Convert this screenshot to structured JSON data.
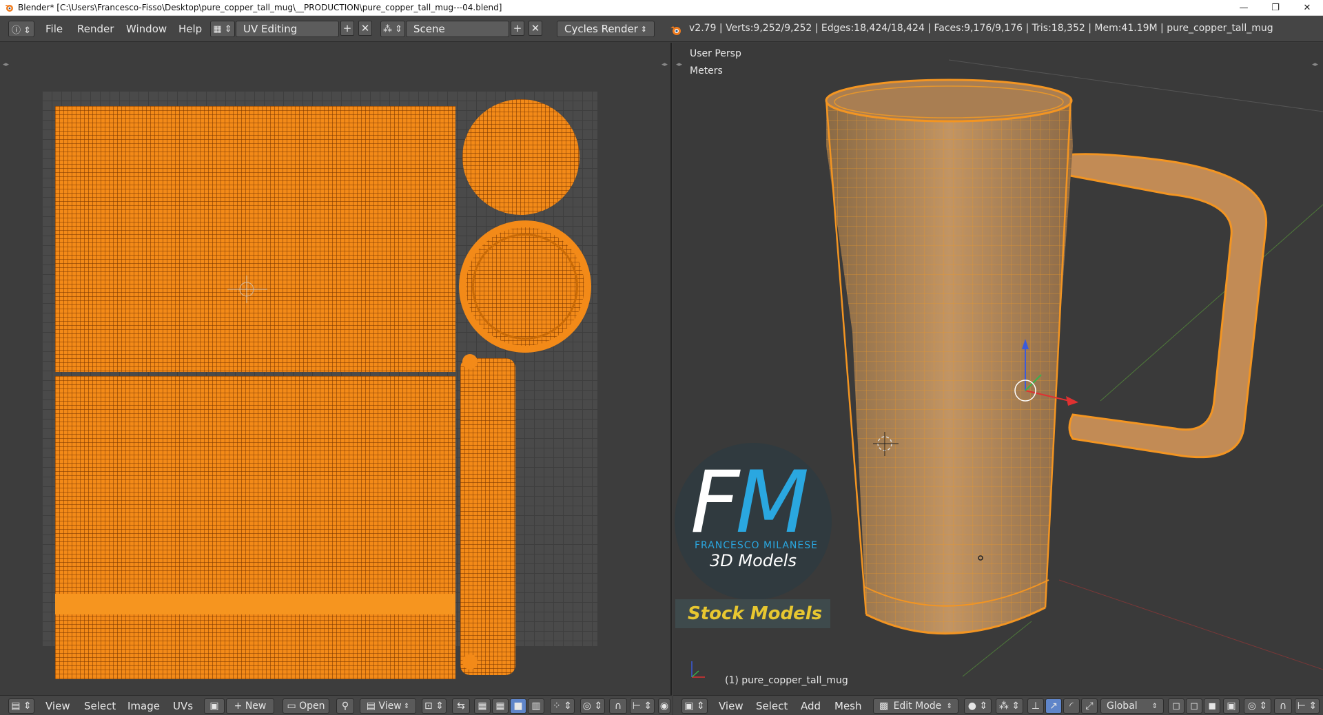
{
  "window": {
    "title": "Blender* [C:\\Users\\Francesco-Fisso\\Desktop\\pure_copper_tall_mug\\__PRODUCTION\\pure_copper_tall_mug---04.blend]",
    "minimize": "—",
    "maximize": "❐",
    "close": "✕"
  },
  "info_header": {
    "menus": [
      "File",
      "Render",
      "Window",
      "Help"
    ],
    "screen_layout": "UV Editing",
    "scene": "Scene",
    "render_engine": "Cycles Render",
    "stats": "v2.79 | Verts:9,252/9,252 | Edges:18,424/18,424 | Faces:9,176/9,176 | Tris:18,352 | Mem:41.19M | pure_copper_tall_mug"
  },
  "uv_editor": {
    "header": {
      "menus": [
        "View",
        "Select",
        "Image",
        "UVs"
      ],
      "new_label": "New",
      "open_label": "Open",
      "view_label": "View"
    }
  },
  "view3d": {
    "view_name": "User Persp",
    "units": "Meters",
    "object_label": "(1) pure_copper_tall_mug",
    "header": {
      "menus": [
        "View",
        "Select",
        "Add",
        "Mesh"
      ],
      "mode": "Edit Mode",
      "orientation": "Global"
    }
  },
  "watermark": {
    "fm_f": "F",
    "fm_m": "M",
    "name": "FRANCESCO MILANESE",
    "line2": "3D Models",
    "line3": "Stock Models"
  },
  "colors": {
    "mesh_orange": "#f38a18",
    "ui_dark": "#3d3d3d",
    "header": "#454545",
    "logo_blue": "#2aa7e0",
    "logo_yellow": "#e8c730"
  }
}
